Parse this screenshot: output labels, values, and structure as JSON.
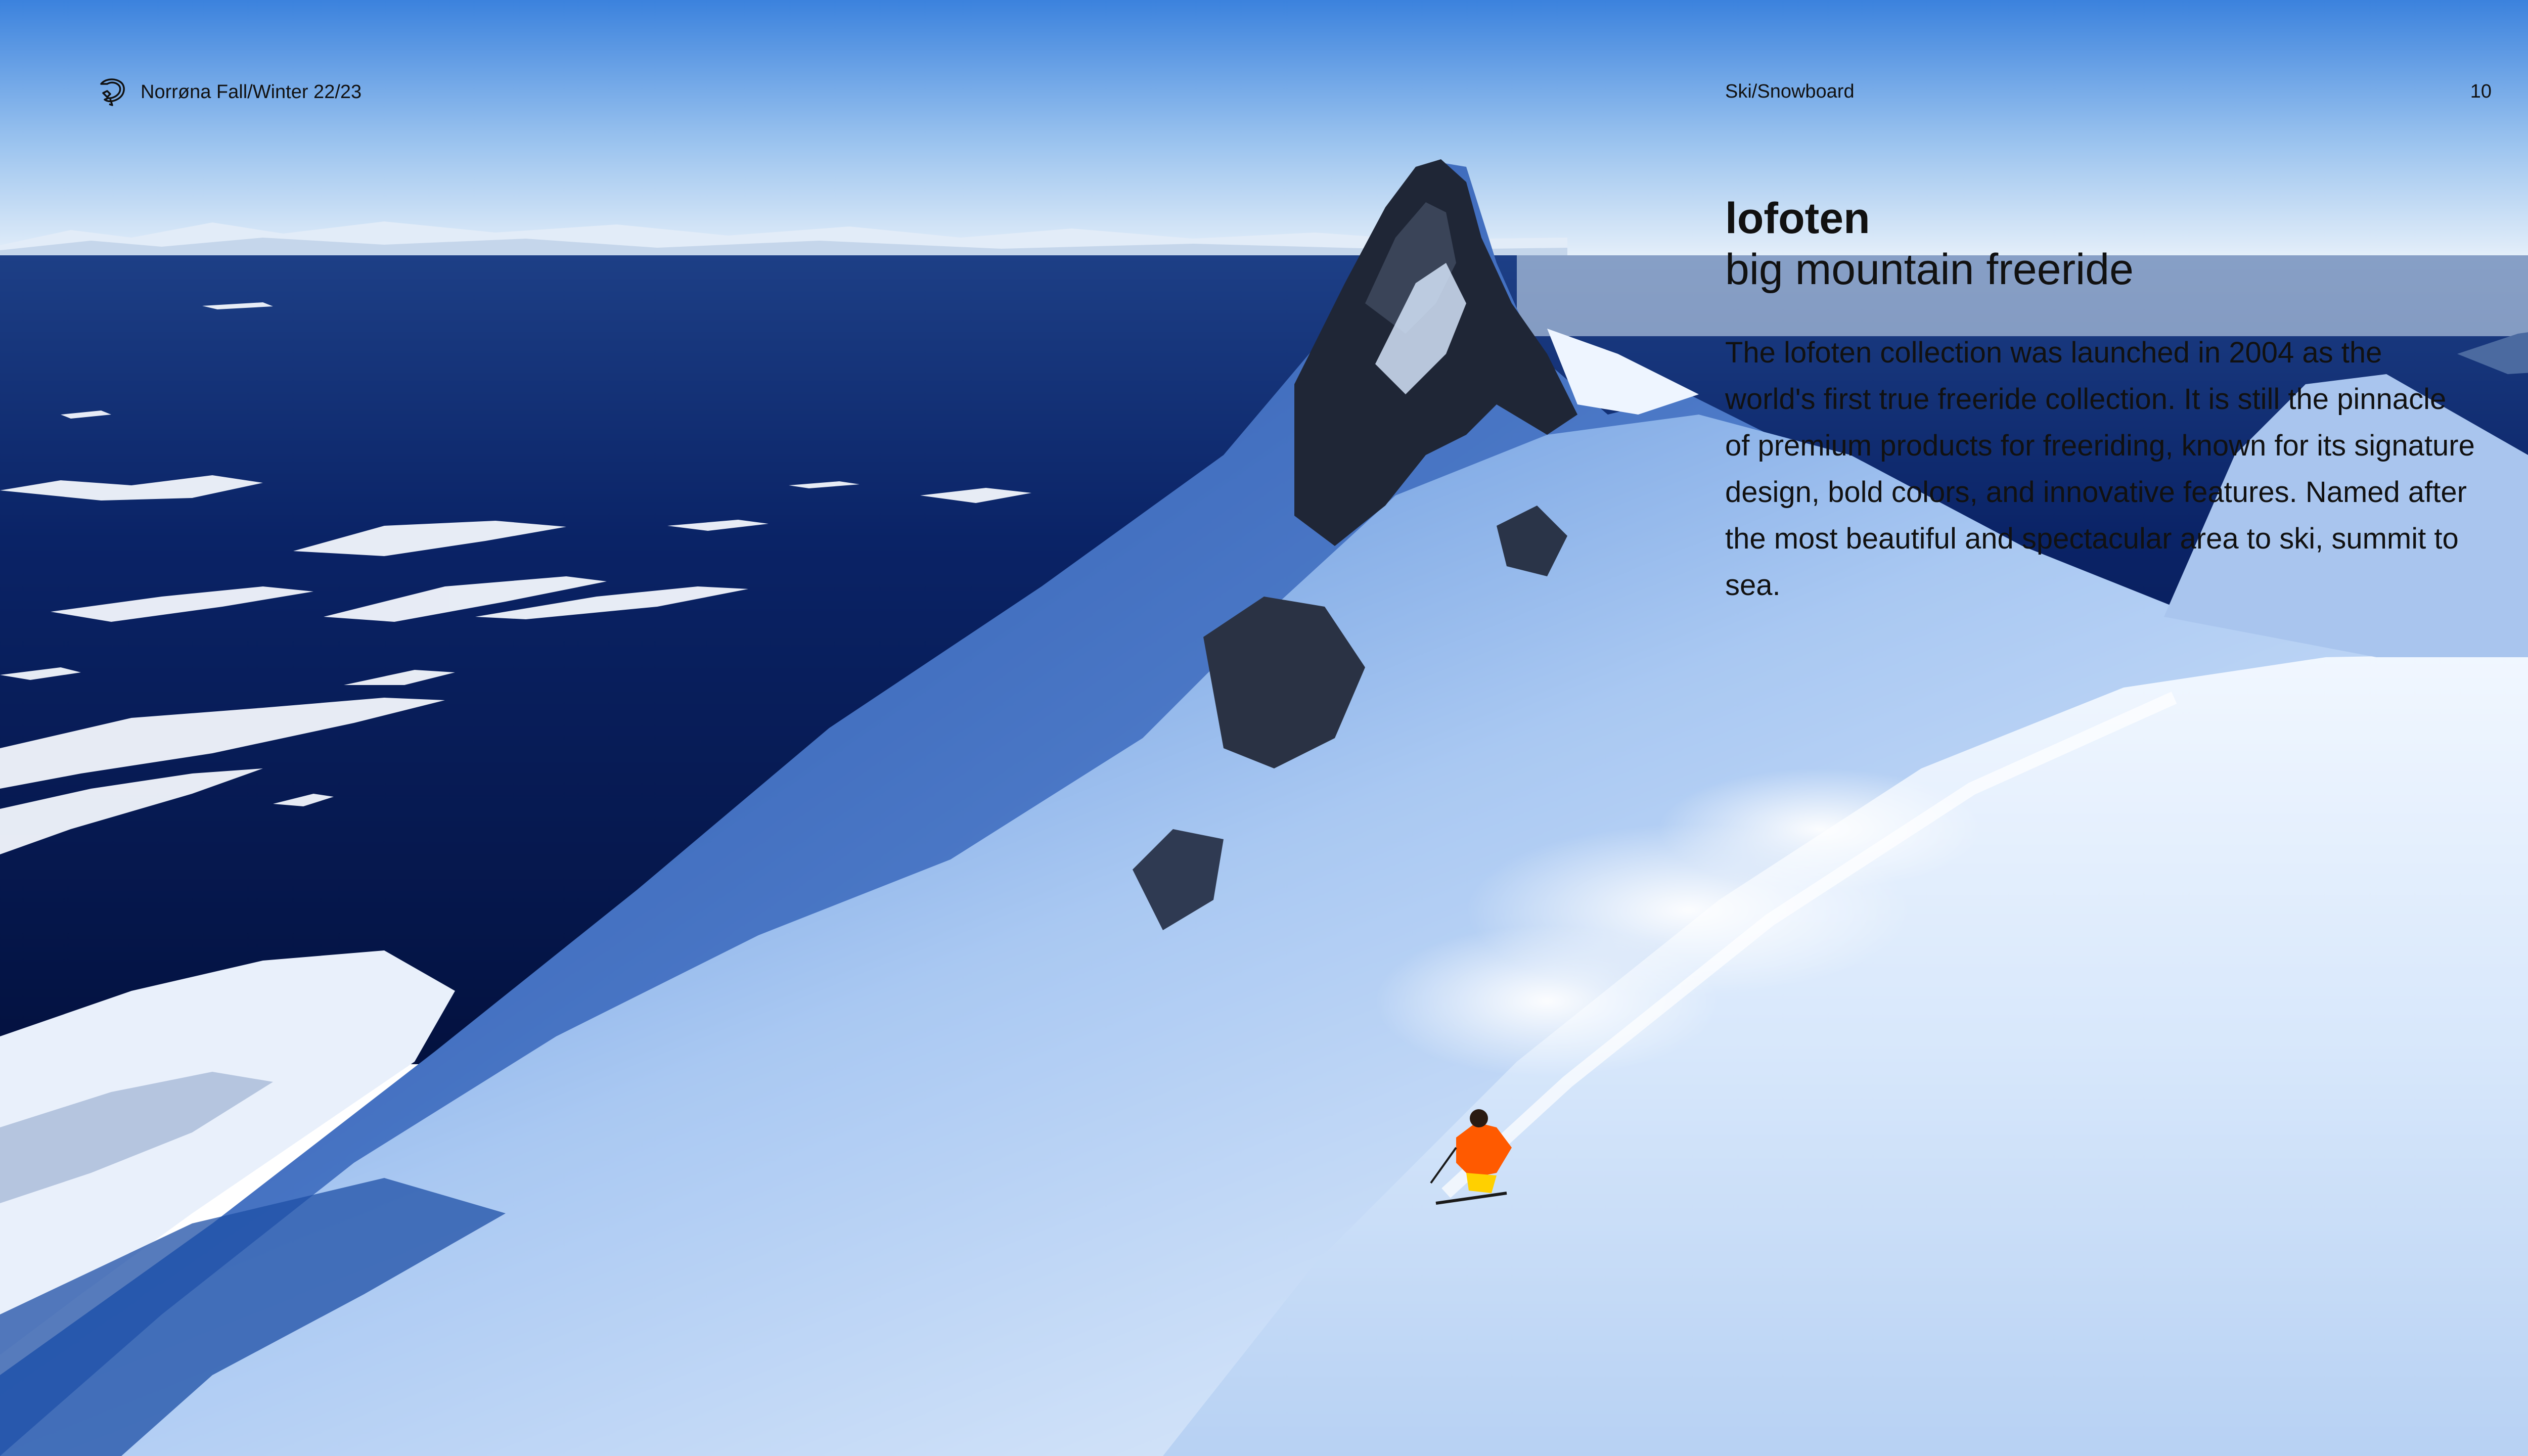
{
  "header": {
    "brand": "Norrøna Fall/Winter 22/23",
    "section": "Ski/Snowboard",
    "page_number": "10"
  },
  "content": {
    "title": "lofoten",
    "subtitle": "big mountain freeride",
    "body": "The lofoten collection was launched in 2004 as the world's first true freeride collection. It is still the pinnacle of premium products for freeriding, known for its signature design, bold colors, and innovative features. Named after the most beautiful and spectacular area to ski, summit to sea."
  },
  "icons": {
    "brand_logo": "norrona-bird-logo-icon"
  },
  "colors": {
    "text": "#111111",
    "sky_top": "#3f86df",
    "sky_bottom": "#dbe9f7",
    "sea": "#061a55",
    "snow": "#ffffff",
    "skier_jacket": "#ff5a00",
    "skier_pants": "#ffd000"
  }
}
